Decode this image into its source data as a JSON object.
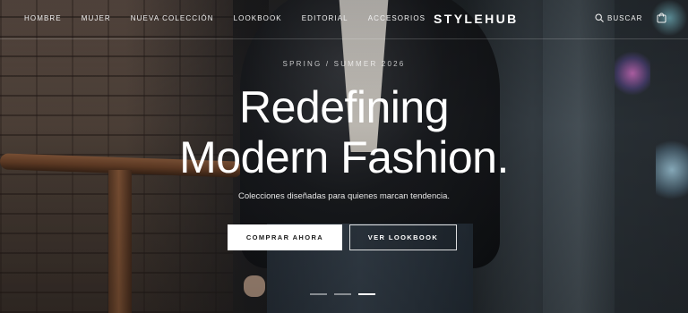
{
  "nav": {
    "links": [
      "HOMBRE",
      "MUJER",
      "NUEVA COLECCIÓN",
      "LOOKBOOK",
      "EDITORIAL",
      "ACCESORIOS"
    ],
    "brand": "STYLEHUB",
    "search_label": "BUSCAR",
    "search_icon": "search-icon",
    "cart_icon": "shopping-bag-icon"
  },
  "hero": {
    "eyebrow": "SPRING / SUMMER 2026",
    "headline_line1": "Redefining",
    "headline_line2": "Modern Fashion.",
    "subline": "Colecciones diseñadas para quienes marcan tendencia.",
    "primary_cta": "COMPRAR AHORA",
    "secondary_cta": "VER LOOKBOOK",
    "slides_total": 3,
    "active_slide": 3
  },
  "colors": {
    "text": "#ffffff",
    "primary_button_bg": "#ffffff",
    "primary_button_text": "#1a1a1a"
  }
}
